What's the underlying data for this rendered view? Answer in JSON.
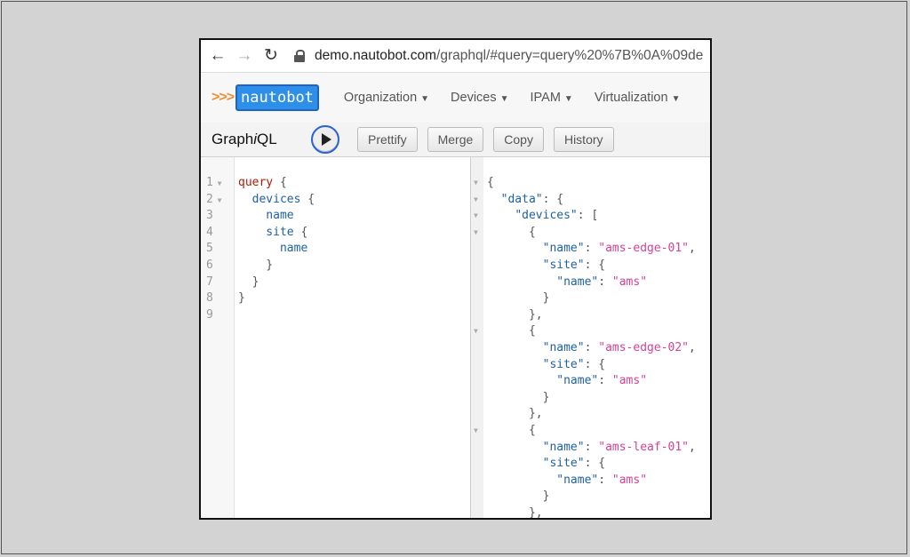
{
  "browser": {
    "url_host": "demo.nautobot.com",
    "url_path": "/graphql/#query=query%20%7B%0A%09de",
    "back_icon": "←",
    "forward_icon": "→",
    "reload_icon": "↻"
  },
  "appnav": {
    "logo_prefix": ">>>",
    "logo_text": "nautobot",
    "menu": [
      {
        "label": "Organization"
      },
      {
        "label": "Devices"
      },
      {
        "label": "IPAM"
      },
      {
        "label": "Virtualization"
      }
    ]
  },
  "graphiql": {
    "title_pre": "Graph",
    "title_i": "i",
    "title_post": "QL",
    "buttons": {
      "prettify": "Prettify",
      "merge": "Merge",
      "copy": "Copy",
      "history": "History"
    }
  },
  "query_editor": {
    "line_numbers": [
      "1",
      "2",
      "3",
      "4",
      "5",
      "6",
      "7",
      "8",
      "9"
    ],
    "lines": [
      {
        "kw": "query",
        "rest": " {"
      },
      {
        "fld": "  devices",
        "rest": " {"
      },
      {
        "fld": "    name",
        "rest": ""
      },
      {
        "fld": "    site",
        "rest": " {"
      },
      {
        "fld": "      name",
        "rest": ""
      },
      {
        "fld": "",
        "rest": "    }"
      },
      {
        "fld": "",
        "rest": "  }"
      },
      {
        "fld": "",
        "rest": "}"
      },
      {
        "fld": "",
        "rest": ""
      }
    ]
  },
  "result": {
    "lines": [
      {
        "pre": "{",
        "key": "",
        "mid": "",
        "str": "",
        "post": ""
      },
      {
        "pre": "  ",
        "key": "\"data\"",
        "mid": ": {",
        "str": "",
        "post": ""
      },
      {
        "pre": "    ",
        "key": "\"devices\"",
        "mid": ": [",
        "str": "",
        "post": ""
      },
      {
        "pre": "      {",
        "key": "",
        "mid": "",
        "str": "",
        "post": ""
      },
      {
        "pre": "        ",
        "key": "\"name\"",
        "mid": ": ",
        "str": "\"ams-edge-01\"",
        "post": ","
      },
      {
        "pre": "        ",
        "key": "\"site\"",
        "mid": ": {",
        "str": "",
        "post": ""
      },
      {
        "pre": "          ",
        "key": "\"name\"",
        "mid": ": ",
        "str": "\"ams\"",
        "post": ""
      },
      {
        "pre": "        }",
        "key": "",
        "mid": "",
        "str": "",
        "post": ""
      },
      {
        "pre": "      },",
        "key": "",
        "mid": "",
        "str": "",
        "post": ""
      },
      {
        "pre": "      {",
        "key": "",
        "mid": "",
        "str": "",
        "post": ""
      },
      {
        "pre": "        ",
        "key": "\"name\"",
        "mid": ": ",
        "str": "\"ams-edge-02\"",
        "post": ","
      },
      {
        "pre": "        ",
        "key": "\"site\"",
        "mid": ": {",
        "str": "",
        "post": ""
      },
      {
        "pre": "          ",
        "key": "\"name\"",
        "mid": ": ",
        "str": "\"ams\"",
        "post": ""
      },
      {
        "pre": "        }",
        "key": "",
        "mid": "",
        "str": "",
        "post": ""
      },
      {
        "pre": "      },",
        "key": "",
        "mid": "",
        "str": "",
        "post": ""
      },
      {
        "pre": "      {",
        "key": "",
        "mid": "",
        "str": "",
        "post": ""
      },
      {
        "pre": "        ",
        "key": "\"name\"",
        "mid": ": ",
        "str": "\"ams-leaf-01\"",
        "post": ","
      },
      {
        "pre": "        ",
        "key": "\"site\"",
        "mid": ": {",
        "str": "",
        "post": ""
      },
      {
        "pre": "          ",
        "key": "\"name\"",
        "mid": ": ",
        "str": "\"ams\"",
        "post": ""
      },
      {
        "pre": "        }",
        "key": "",
        "mid": "",
        "str": "",
        "post": ""
      },
      {
        "pre": "      },",
        "key": "",
        "mid": "",
        "str": "",
        "post": ""
      }
    ]
  }
}
